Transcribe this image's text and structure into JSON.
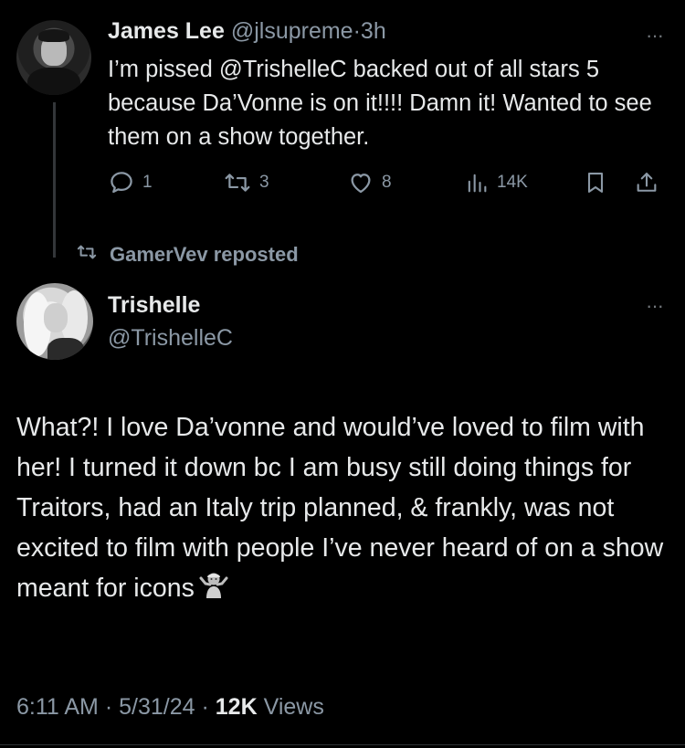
{
  "parent_tweet": {
    "display_name": "James Lee",
    "handle": "@jlsupreme",
    "separator": "·",
    "time": "3h",
    "text_before_mention": "I’m pissed ",
    "mention": "@TrishelleC",
    "text_after_mention": " backed out of all stars 5 because Da’Vonne is on it!!!! Damn it! Wanted to see them on a show together.",
    "more_label": "···",
    "actions": {
      "replies": "1",
      "reposts": "3",
      "likes": "8",
      "views": "14K"
    }
  },
  "repost_banner": {
    "label": "GamerVev reposted"
  },
  "main_tweet": {
    "display_name": "Trishelle",
    "handle": "@TrishelleC",
    "more_label": "···",
    "text": "What?! I love Da’vonne and would’ve loved to film with her! I turned it down bc I am busy still doing things for Traitors, had an Italy trip planned, & frankly, was not excited to film with people I’ve never heard of on a show meant for icons",
    "emoji": "🤷‍♀️",
    "time": "6:11 AM",
    "separator": "·",
    "date": "5/31/24",
    "view_count": "12K",
    "views_label": "Views"
  },
  "icons": {
    "reply": "reply-icon",
    "repost": "repost-icon",
    "like": "heart-icon",
    "views": "analytics-icon",
    "bookmark": "bookmark-icon",
    "share": "share-icon",
    "more": "more-icon"
  },
  "colors": {
    "background": "#000000",
    "text": "#e7e9ea",
    "muted": "#8b98a5",
    "thread_line": "#333639"
  }
}
